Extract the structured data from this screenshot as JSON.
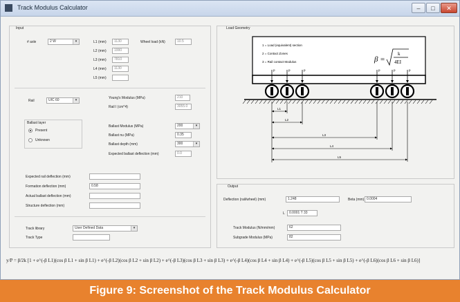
{
  "window": {
    "title": "Track Modulus Calculator",
    "minimize": "–",
    "maximize": "□",
    "close": "✕"
  },
  "input": {
    "group_title": "Input",
    "axle_label": "# axle",
    "axle_value": "2 W",
    "l1_label": "L1 (mm)",
    "l1_value": "1130",
    "l2_label": "L2 (mm)",
    "l2_value": "1990",
    "l3_label": "L3 (mm)",
    "l3_value": "7810",
    "l4_label": "L4 (mm)",
    "l4_value": "1130",
    "l5_label": "L5 (mm)",
    "l5_value": "",
    "wheel_load_label": "Wheel load (kN)",
    "wheel_load_value": "10.5",
    "rail_label": "Rail",
    "rail_value": "UIC 60",
    "rail_E_label": "Young's Modulus (MPa)",
    "rail_E_value": "210",
    "rail_I_label": "Rail I (cm^4)",
    "rail_I_value": "3055.0",
    "ballast_group": "Ballast layer",
    "opt_present": "Present",
    "opt_unknown": "Unknown",
    "ballast_mod_label": "Ballast Modulus (MPa)",
    "ballast_mod_value": "200",
    "ballast_nu_label": "Ballast nu (MPa)",
    "ballast_nu_value": "0.35",
    "ballast_depth_label": "Ballast depth (mm)",
    "ballast_depth_value": "300",
    "ballast_defl_label": "Expected ballast deflection (mm)",
    "ballast_defl_value": "0.0",
    "exp_rail_label": "Expected rail deflection (mm)",
    "exp_rail_value": "",
    "formation_label": "Formation deflection (mm)",
    "formation_value": "0.58",
    "actual_ballast_label": "Actual ballast deflection (mm)",
    "actual_ballast_value": "",
    "structure_label": "Structure deflection (mm)",
    "structure_value": "",
    "track_library_label": "Track library",
    "track_library_value": "User Defined Data",
    "track_type_label": "Track Type",
    "track_type_value": ""
  },
  "geometry": {
    "group_title": "Load Geometry",
    "legend_1": "1 = Load (equivalent) section",
    "legend_2": "2 = Contact Zones",
    "legend_3": "3 = Rail contact Modulus",
    "beta": "β =",
    "formula_num": "k",
    "formula_den": "4EI",
    "load_labels": [
      "p",
      "p",
      "p",
      "p",
      "p",
      "p"
    ],
    "dim_labels": [
      "L1",
      "L2",
      "L3",
      "L4",
      "L5"
    ]
  },
  "output": {
    "group_title": "Output",
    "rail_defl_label": "Deflection (rail/wheel) (mm)",
    "rail_defl_value": "1.248",
    "beta_label": "Beta (mm)",
    "beta_value": "0.0004",
    "l_label": "L",
    "l_value": "0.0001 T 33",
    "track_mod_label": "Track Modulus (N/mm/mm)",
    "track_mod_value": "62",
    "subgrade_label": "Subgrade Modulus (MPa)",
    "subgrade_value": "82"
  },
  "equation": "y/P = β/2k [1 + e^(-β L1)(cos β L1 + sin β L1) + e^(-β L2)(cos β L2 + sin β L2) + e^(-β L3)(cos β L3 + sin β L3) + e^(-β L4)(cos β L4 + sin β L4) + e^(-β L5)(cos β L5 + sin β L5) + e^(-β L6)(cos β L6 + sin β L6)]",
  "caption": "Figure 9: Screenshot of the Track Modulus Calculator"
}
